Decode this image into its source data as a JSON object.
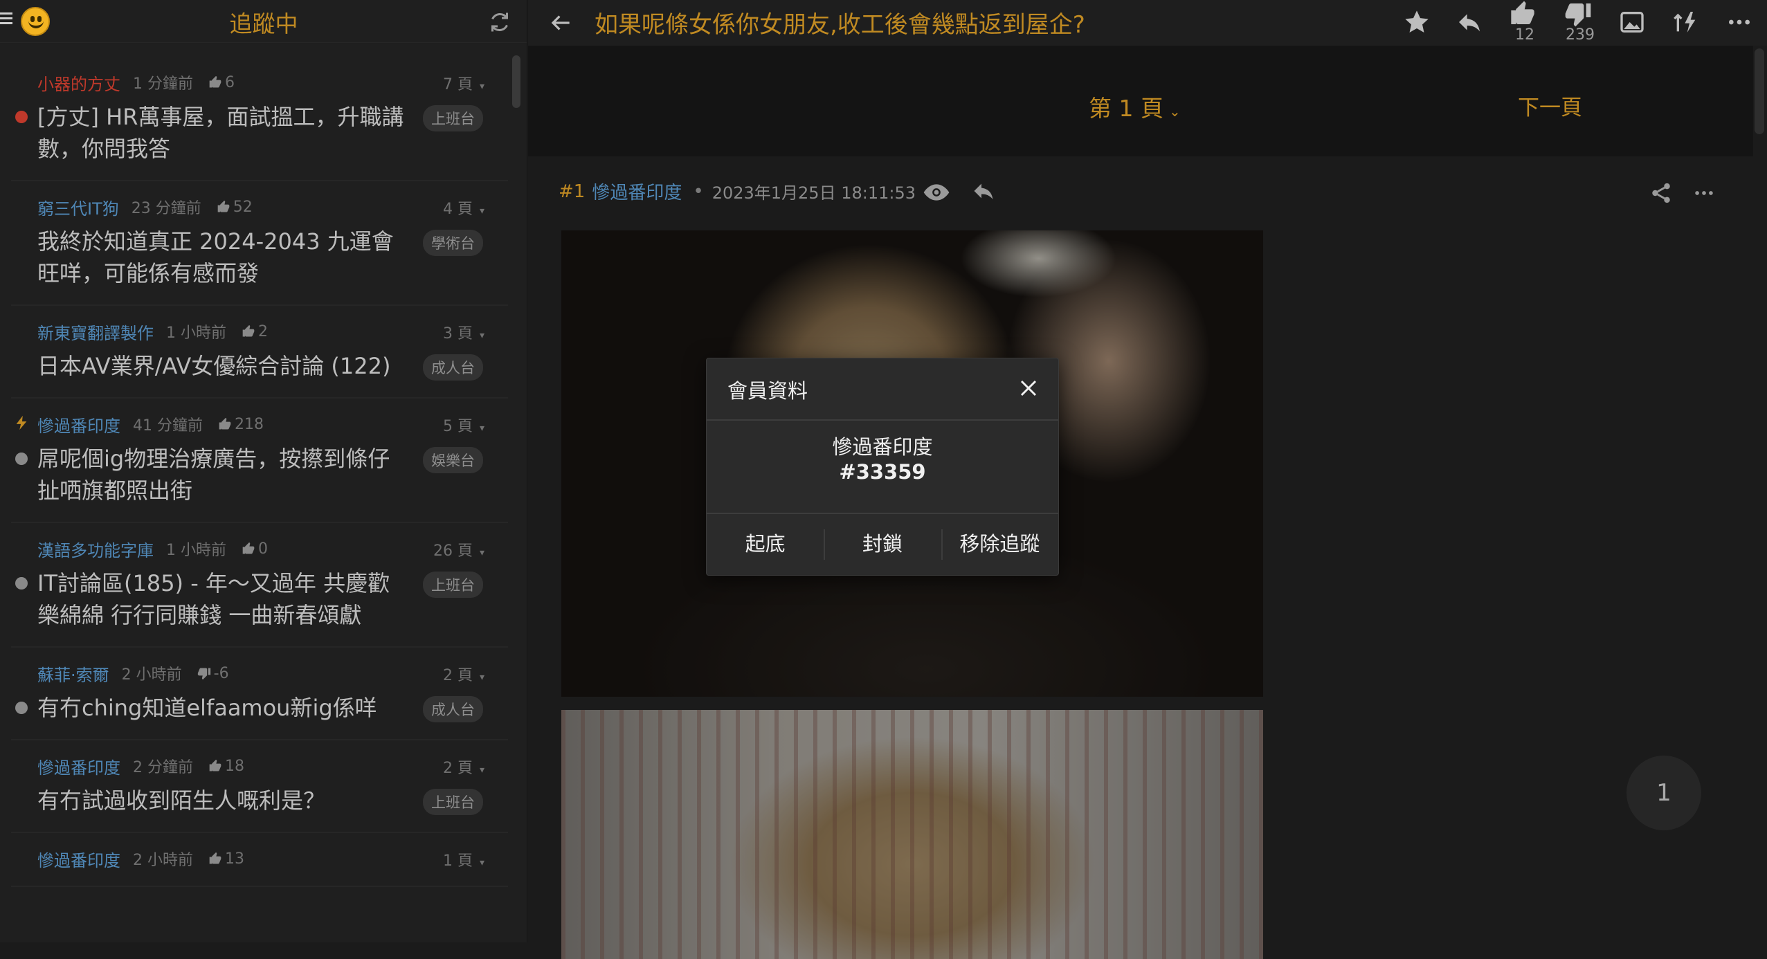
{
  "sidebar": {
    "title": "追蹤中",
    "threads": [
      {
        "author": "小器的方丈",
        "author_color": "red",
        "time": "1 分鐘前",
        "likes": "6",
        "vote": "up",
        "pages": "7 頁",
        "title": "[方丈] HR萬事屋，面試搵工，升職講數，你問我答",
        "badge": "上班台",
        "dot": "red"
      },
      {
        "author": "窮三代IT狗",
        "time": "23 分鐘前",
        "likes": "52",
        "vote": "up",
        "pages": "4 頁",
        "title": "我終於知道真正 2024-2043 九運會旺咩，可能係有感而發",
        "badge": "學術台",
        "dot": "none"
      },
      {
        "author": "新東寶翻譯製作",
        "time": "1 小時前",
        "likes": "2",
        "vote": "up",
        "pages": "3 頁",
        "title": "日本AV業界/AV女優綜合討論 (122)",
        "badge": "成人台",
        "dot": "none"
      },
      {
        "author": "慘過番印度",
        "time": "41 分鐘前",
        "likes": "218",
        "vote": "up",
        "pages": "5 頁",
        "title": "屌呢個ig物理治療廣告，按攃到條仔扯哂旗都照出街",
        "badge": "娛樂台",
        "dot": "grey",
        "bolt": true
      },
      {
        "author": "漢語多功能字庫",
        "time": "1 小時前",
        "likes": "0",
        "vote": "up",
        "pages": "26 頁",
        "title": "IT討論區(185) - 年～又過年 共慶歡樂綿綿 行行同賺錢 一曲新春頌獻",
        "badge": "上班台",
        "dot": "grey"
      },
      {
        "author": "蘇菲·索爾",
        "time": "2 小時前",
        "likes": "-6",
        "vote": "down",
        "pages": "2 頁",
        "title": "有冇ching知道elfaamou新ig係咩",
        "badge": "成人台",
        "dot": "grey"
      },
      {
        "author": "慘過番印度",
        "time": "2 分鐘前",
        "likes": "18",
        "vote": "up",
        "pages": "2 頁",
        "title": "有冇試過收到陌生人嘅利是？",
        "badge": "上班台",
        "dot": "none"
      },
      {
        "author": "慘過番印度",
        "time": "2 小時前",
        "likes": "13",
        "vote": "up",
        "pages": "1 頁",
        "title": "",
        "badge": "",
        "dot": "none"
      }
    ]
  },
  "topbar": {
    "thread_title": "如果呢條女係你女朋友,收工後會幾點返到屋企?",
    "likes": "12",
    "dislikes": "239"
  },
  "pager": {
    "current": "第 1 頁",
    "next": "下一頁"
  },
  "post": {
    "number": "#1",
    "author": "慘過番印度",
    "datetime": "2023年1月25日 18:11:53"
  },
  "float_page": "1",
  "modal": {
    "title": "會員資料",
    "name": "慘過番印度",
    "uid": "#33359",
    "actions": [
      "起底",
      "封鎖",
      "移除追蹤"
    ]
  },
  "colors": {
    "accent": "#c08a22",
    "author_blue": "#4f87b6",
    "red": "#c0392b",
    "background": "#1b1b1b"
  }
}
